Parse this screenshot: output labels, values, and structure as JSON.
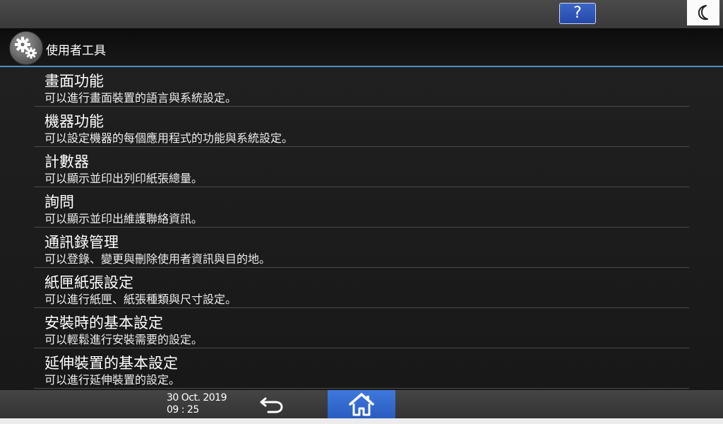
{
  "topbar": {
    "help_label": "?",
    "sleep_icon": "moon-icon"
  },
  "header": {
    "icon": "gears-icon",
    "title": "使用者工具"
  },
  "menu": {
    "items": [
      {
        "title": "畫面功能",
        "description": "可以進行畫面裝置的語言與系統設定。"
      },
      {
        "title": "機器功能",
        "description": "可以設定機器的每個應用程式的功能與系統設定。"
      },
      {
        "title": "計數器",
        "description": "可以顯示並印出列印紙張總量。"
      },
      {
        "title": "詢問",
        "description": "可以顯示並印出維護聯絡資訊。"
      },
      {
        "title": "通訊錄管理",
        "description": "可以登錄、變更與刪除使用者資訊與目的地。"
      },
      {
        "title": "紙匣紙張設定",
        "description": "可以進行紙匣、紙張種類與尺寸設定。"
      },
      {
        "title": "安裝時的基本設定",
        "description": "可以輕鬆進行安裝需要的設定。"
      },
      {
        "title": "延伸裝置的基本設定",
        "description": "可以進行延伸裝置的設定。"
      }
    ]
  },
  "bottombar": {
    "date": "30 Oct. 2019",
    "time": "09 : 25",
    "back_icon": "back-arrow-icon",
    "home_icon": "home-icon"
  },
  "colors": {
    "accent_line": "#4a8fc4",
    "home_button": "#2f66d0",
    "help_button": "#2f57b8",
    "background": "#1b1b1b"
  }
}
